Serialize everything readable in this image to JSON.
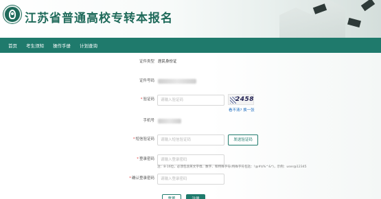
{
  "header": {
    "title": "江苏省普通高校专转本报名"
  },
  "nav": {
    "items": [
      "首页",
      "考生须知",
      "操作手册",
      "计划查询"
    ]
  },
  "form": {
    "id_type": {
      "label": "证件类型",
      "value": "居民身份证"
    },
    "id_number": {
      "label": "证件号码"
    },
    "captcha": {
      "label": "验证码",
      "placeholder": "请输入验证码",
      "image_text": "2458",
      "refresh_link": "看不清? 换一张"
    },
    "phone": {
      "label": "手机号"
    },
    "sms_code": {
      "label": "短信验证码",
      "placeholder": "请输入短信验证码",
      "button": "发送验证码"
    },
    "password": {
      "label": "登录密码",
      "placeholder": "请输入登录密码",
      "hint": "注：8-16位，必须包含英文字母、数字、和特殊字符(特殊字符包括：!@#$%^&*)，示例：user@12345"
    },
    "confirm_password": {
      "label": "确认登录密码",
      "placeholder": "请输入登录密码"
    },
    "reset_label": "重置",
    "submit_label": "注册"
  },
  "colors": {
    "primary": "#1f7a6c",
    "title": "#1f6a5a",
    "required": "#e03b3b",
    "link": "#1f6ec0"
  }
}
